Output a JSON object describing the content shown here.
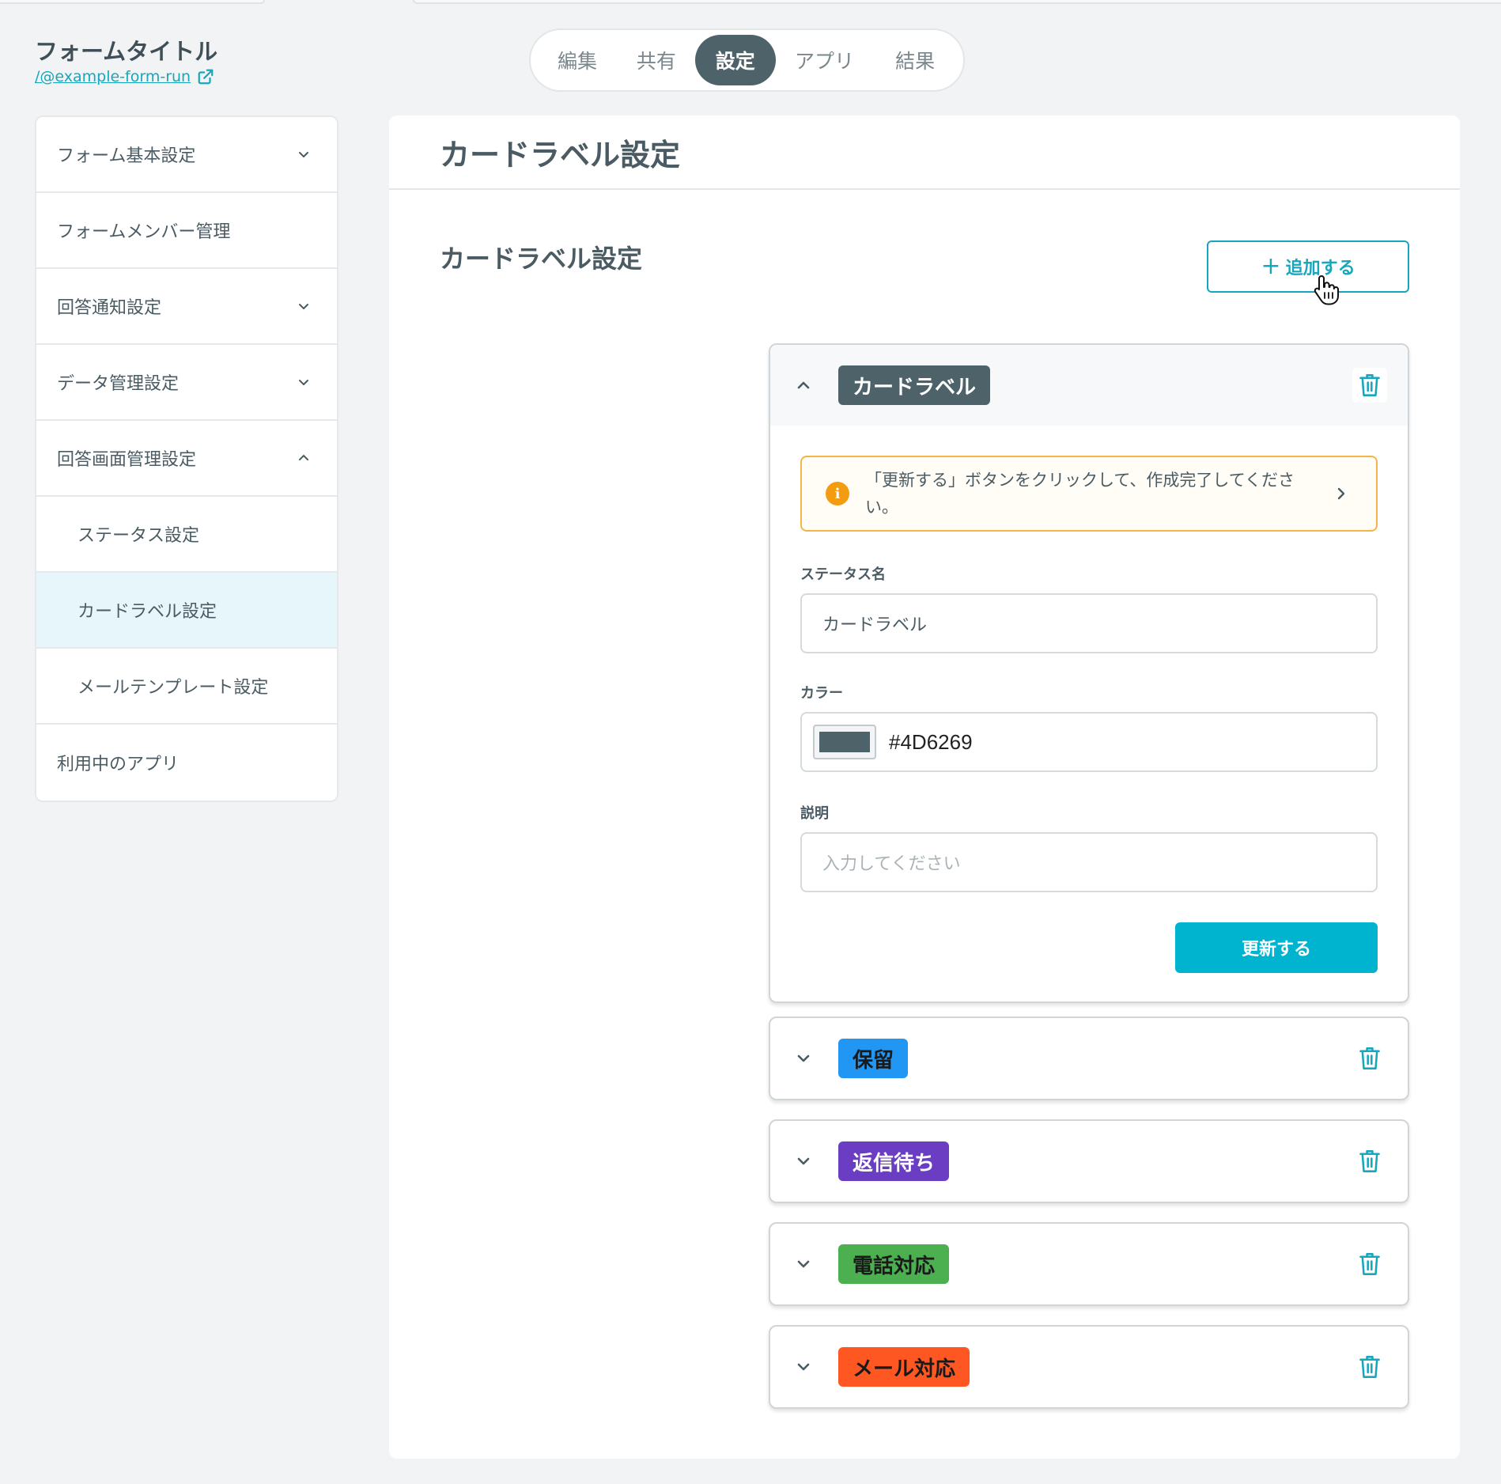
{
  "header": {
    "form_title": "フォームタイトル",
    "form_link": "/@example-form-run"
  },
  "tabs": [
    {
      "label": "編集",
      "active": false
    },
    {
      "label": "共有",
      "active": false
    },
    {
      "label": "設定",
      "active": true
    },
    {
      "label": "アプリ",
      "active": false
    },
    {
      "label": "結果",
      "active": false
    }
  ],
  "sidebar": {
    "items": [
      {
        "label": "フォーム基本設定",
        "chevron": "down"
      },
      {
        "label": "フォームメンバー管理",
        "chevron": "none"
      },
      {
        "label": "回答通知設定",
        "chevron": "down"
      },
      {
        "label": "データ管理設定",
        "chevron": "down"
      },
      {
        "label": "回答画面管理設定",
        "chevron": "up"
      },
      {
        "label": "ステータス設定",
        "sub": true
      },
      {
        "label": "カードラベル設定",
        "sub": true,
        "selected": true
      },
      {
        "label": "メールテンプレート設定",
        "sub": true
      },
      {
        "label": "利用中のアプリ",
        "chevron": "none"
      }
    ]
  },
  "main": {
    "title": "カードラベル設定",
    "section_title": "カードラベル設定",
    "add_button_label": "追加する",
    "editor": {
      "label": "カードラベル",
      "label_color": "#4D6269",
      "notice": "「更新する」ボタンをクリックして、作成完了してください。",
      "status_name_label": "ステータス名",
      "status_name_value": "カードラベル",
      "color_label": "カラー",
      "color_value": "#4D6269",
      "description_label": "説明",
      "description_placeholder": "入力してください",
      "update_button_label": "更新する"
    },
    "labels": [
      {
        "label": "保留",
        "color": "#2196F3",
        "text_color": "#1a1a1a"
      },
      {
        "label": "返信待ち",
        "color": "#6A3DC2",
        "text_color": "#ffffff"
      },
      {
        "label": "電話対応",
        "color": "#4CAF50",
        "text_color": "#1a1a1a"
      },
      {
        "label": "メール対応",
        "color": "#FF5722",
        "text_color": "#1a1a1a"
      }
    ]
  },
  "colors": {
    "accent": "#17A7BD",
    "primary_button": "#00B4D0",
    "tab_active": "#4D6269",
    "notice_border": "#F3B549"
  }
}
